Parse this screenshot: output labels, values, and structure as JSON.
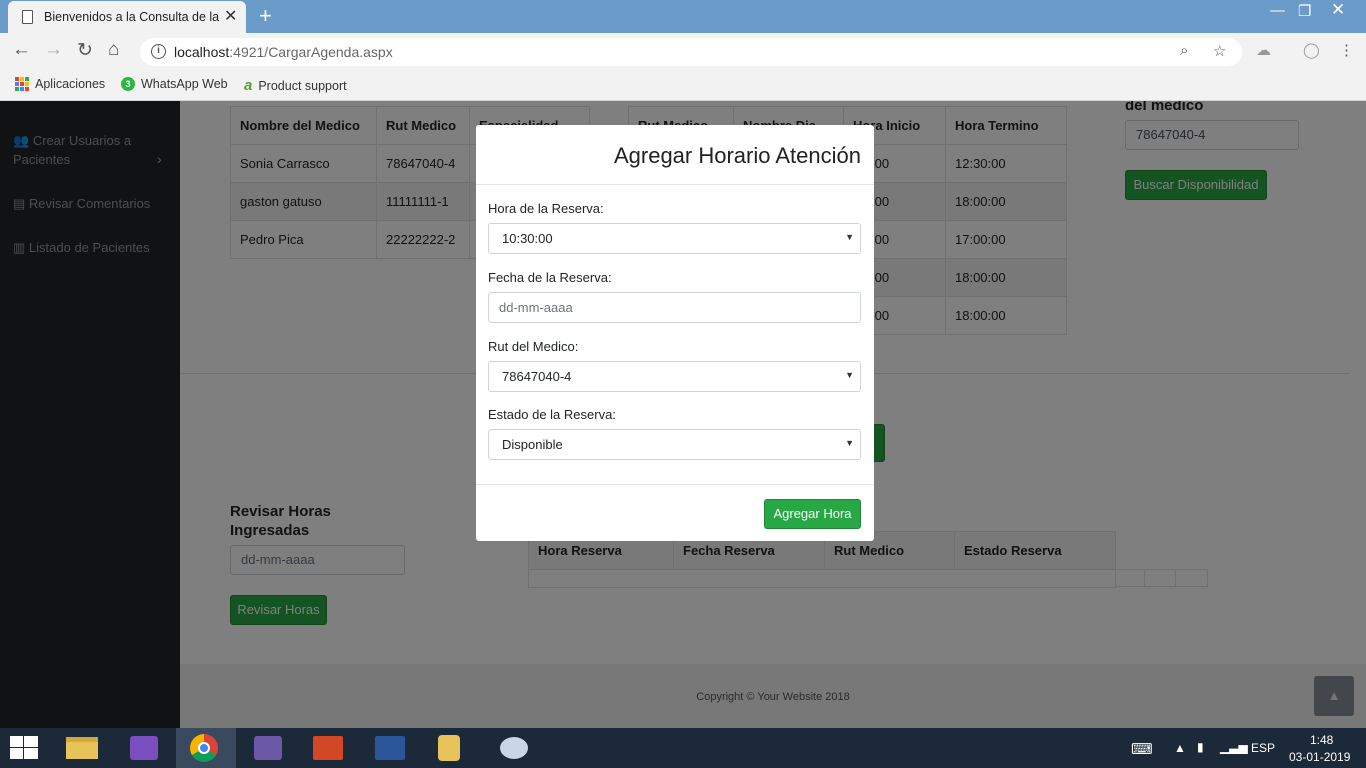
{
  "browser": {
    "tab_title": "Bienvenidos a la Consulta de la D",
    "url_host": "localhost",
    "url_path": ":4921/CargarAgenda.aspx",
    "bookmarks": [
      "Aplicaciones",
      "WhatsApp Web",
      "Product support"
    ]
  },
  "sidebar": {
    "items": [
      {
        "icon": "users-icon",
        "label": "Crear Usuarios a Pacientes"
      },
      {
        "icon": "book-icon",
        "label": "Revisar Comentarios"
      },
      {
        "icon": "chart-icon",
        "label": "Listado de Pacientes"
      }
    ]
  },
  "doctors_table": {
    "headers": [
      "Nombre del Medico",
      "Rut Medico",
      "Especialidad"
    ],
    "rows": [
      [
        "Sonia Carrasco",
        "78647040-4",
        ""
      ],
      [
        "gaston gatuso",
        "11111111-1",
        ""
      ],
      [
        "Pedro Pica",
        "22222222-2",
        ""
      ]
    ]
  },
  "schedule_table": {
    "headers": [
      "Rut Medico",
      "Nombre Dia",
      "Hora Inicio",
      "Hora Termino"
    ],
    "rows": [
      [
        "",
        "",
        ":00:00",
        "12:30:00"
      ],
      [
        "",
        "",
        ":00:00",
        "18:00:00"
      ],
      [
        "",
        "",
        ":00:00",
        "17:00:00"
      ],
      [
        "",
        "",
        ":00:00",
        "18:00:00"
      ],
      [
        "",
        "",
        ":00:00",
        "18:00:00"
      ]
    ]
  },
  "search_panel": {
    "label": "del medico",
    "value": "78647040-4",
    "button": "Buscar Disponibilidad"
  },
  "review_panel": {
    "label": "Revisar Horas Ingresadas",
    "placeholder": "dd-mm-aaaa",
    "button": "Revisar Horas"
  },
  "reservations_table": {
    "headers": [
      "Hora Reserva",
      "Fecha Reserva",
      "Rut Medico",
      "Estado Reserva"
    ]
  },
  "footer": {
    "copyright": "Copyright © Your Website 2018"
  },
  "modal": {
    "title": "Agregar Horario Atención",
    "hora_label": "Hora de la Reserva:",
    "hora_value": "10:30:00",
    "fecha_label": "Fecha de la Reserva:",
    "fecha_placeholder": "dd-mm-aaaa",
    "rut_label": "Rut del Medico:",
    "rut_value": "78647040-4",
    "estado_label": "Estado de la Reserva:",
    "estado_value": "Disponible",
    "submit": "Agregar Hora"
  },
  "taskbar": {
    "language": "ESP",
    "time": "1:48",
    "date": "03-01-2019"
  },
  "colors": {
    "accent_green": "#28a745",
    "sidebar": "#212529",
    "titlebar": "#6a9bc9",
    "taskbar": "#1c2938"
  }
}
